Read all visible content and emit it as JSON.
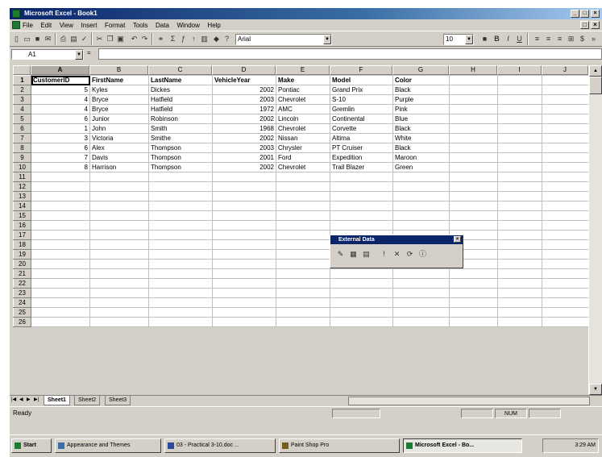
{
  "window": {
    "title": "Microsoft Excel - Book1"
  },
  "menu": [
    "File",
    "Edit",
    "View",
    "Insert",
    "Format",
    "Tools",
    "Data",
    "Window",
    "Help"
  ],
  "toolbar": {
    "font": "Arial",
    "size": "10"
  },
  "formula_bar": {
    "name_box": "A1",
    "content": ""
  },
  "columns": [
    "A",
    "B",
    "C",
    "D",
    "E",
    "F",
    "G",
    "H",
    "I",
    "J"
  ],
  "headers": [
    "CustomerID",
    "FirstName",
    "LastName",
    "VehicleYear",
    "Make",
    "Model",
    "Color"
  ],
  "rows": [
    {
      "id": "5",
      "first": "Kyles",
      "last": "Dickes",
      "year": "2002",
      "make": "Pontiac",
      "model": "Grand Prix",
      "color": "Black"
    },
    {
      "id": "4",
      "first": "Bryce",
      "last": "Hatfield",
      "year": "2003",
      "make": "Chevrolet",
      "model": "S-10",
      "color": "Purple"
    },
    {
      "id": "4",
      "first": "Bryce",
      "last": "Hatfield",
      "year": "1972",
      "make": "AMC",
      "model": "Gremlin",
      "color": "Pink"
    },
    {
      "id": "6",
      "first": "Junior",
      "last": "Robinson",
      "year": "2002",
      "make": "Lincoln",
      "model": "Continental",
      "color": "Blue"
    },
    {
      "id": "1",
      "first": "John",
      "last": "Smith",
      "year": "1968",
      "make": "Chevrolet",
      "model": "Corvette",
      "color": "Black"
    },
    {
      "id": "3",
      "first": "Victoria",
      "last": "Smithe",
      "year": "2002",
      "make": "Nissan",
      "model": "Altima",
      "color": "White"
    },
    {
      "id": "6",
      "first": "Alex",
      "last": "Thompson",
      "year": "2003",
      "make": "Chrysler",
      "model": "PT Cruiser",
      "color": "Black"
    },
    {
      "id": "7",
      "first": "Davis",
      "last": "Thompson",
      "year": "2001",
      "make": "Ford",
      "model": "Expedition",
      "color": "Maroon"
    },
    {
      "id": "8",
      "first": "Harrison",
      "last": "Thompson",
      "year": "2002",
      "make": "Chevrolet",
      "model": "Trail Blazer",
      "color": "Green"
    }
  ],
  "row_numbers": [
    "1",
    "2",
    "3",
    "4",
    "5",
    "6",
    "7",
    "8",
    "9",
    "10",
    "11",
    "12",
    "13",
    "14",
    "15",
    "16",
    "17",
    "18",
    "19",
    "20",
    "21",
    "22",
    "23",
    "24",
    "25",
    "26"
  ],
  "external_data_toolbar": {
    "title": "External Data"
  },
  "sheet_tabs": [
    "Sheet1",
    "Sheet2",
    "Sheet3"
  ],
  "status": {
    "text": "Ready",
    "num": "NUM"
  },
  "taskbar": {
    "start": "Start",
    "tasks": [
      "Appearance and Themes",
      "03 - Practical 3-10.doc ...",
      "Paint Shop Pro",
      "Microsoft Excel - Bo..."
    ],
    "clock": "3:29 AM"
  }
}
